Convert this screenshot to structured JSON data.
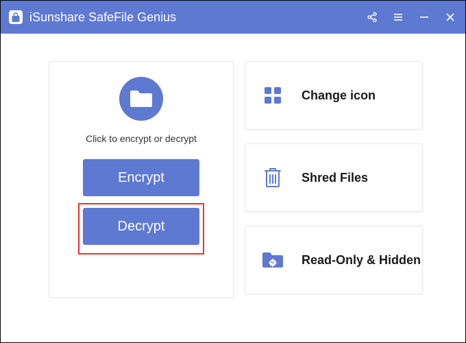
{
  "app": {
    "title": "iSunshare SafeFile Genius"
  },
  "colors": {
    "primary": "#5e79d2",
    "highlight": "#e63434"
  },
  "left": {
    "hint": "Click to encrypt or decrypt",
    "encrypt_label": "Encrypt",
    "decrypt_label": "Decrypt"
  },
  "features": {
    "change_icon": "Change icon",
    "shred_files": "Shred Files",
    "read_only_hidden": "Read-Only & Hidden"
  }
}
